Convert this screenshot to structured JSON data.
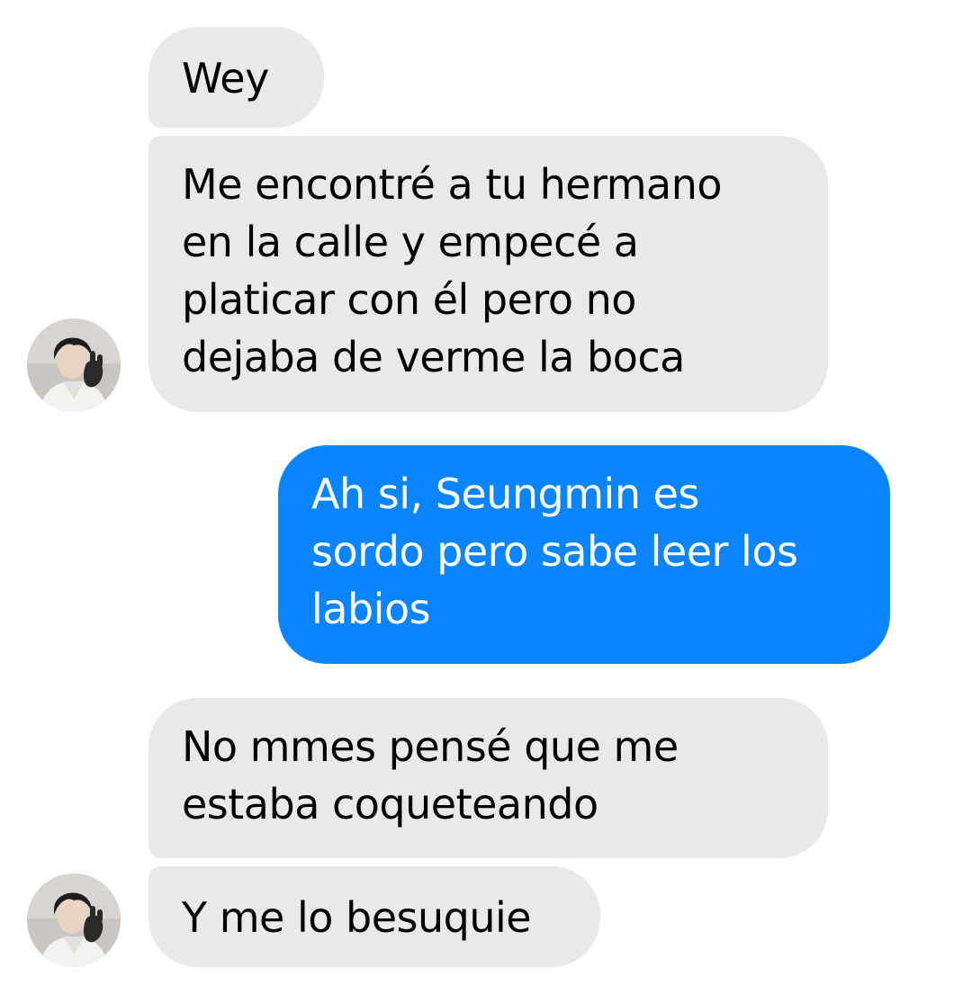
{
  "conversation": {
    "messages": [
      {
        "sender": "contact",
        "text": "Wey"
      },
      {
        "sender": "contact",
        "text": "Me encontré a tu hermano\nen la calle y empecé a\nplaticar con él pero no\ndejaba de verme la boca"
      },
      {
        "sender": "me",
        "text": "Ah si, Seungmin es\nsordo pero sabe leer los\nlabios"
      },
      {
        "sender": "contact",
        "text": "No mmes pensé que me\nestaba coqueteando"
      },
      {
        "sender": "contact",
        "text": "Y me lo besuquie"
      }
    ],
    "colors": {
      "incoming_bubble": "#e9e9eb",
      "outgoing_bubble": "#0a84ff",
      "incoming_text": "#000000",
      "outgoing_text": "#ffffff"
    },
    "avatar_icon": "contact-avatar-photo"
  }
}
